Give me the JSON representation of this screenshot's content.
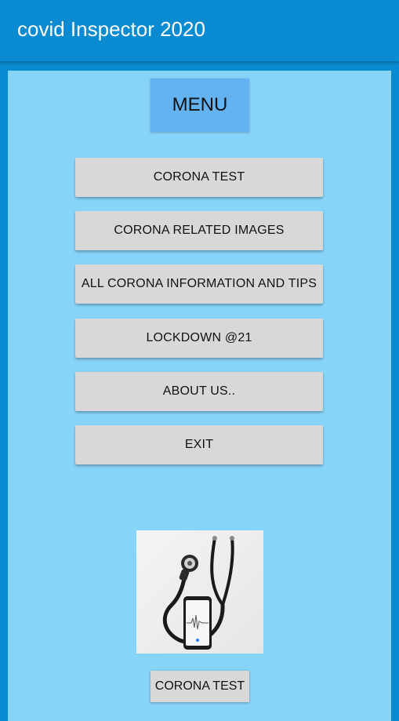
{
  "app_bar": {
    "title": "covid Inspector 2020"
  },
  "main": {
    "heading": "MENU",
    "menu_items": [
      {
        "label": "CORONA TEST"
      },
      {
        "label": "CORONA RELATED IMAGES"
      },
      {
        "label": "ALL CORONA INFORMATION AND TIPS"
      },
      {
        "label": "LOCKDOWN @21"
      },
      {
        "label": "ABOUT US.."
      },
      {
        "label": "EXIT"
      }
    ],
    "image": {
      "icon": "stethoscope-with-phone-image"
    },
    "bottom_button": {
      "label": "CORONA TEST"
    }
  },
  "colors": {
    "app_bar": "#0a8bd1",
    "content_bg": "#87d4f9",
    "menu_heading_bg": "#63b3f3",
    "button_bg": "#d8d8d8"
  }
}
